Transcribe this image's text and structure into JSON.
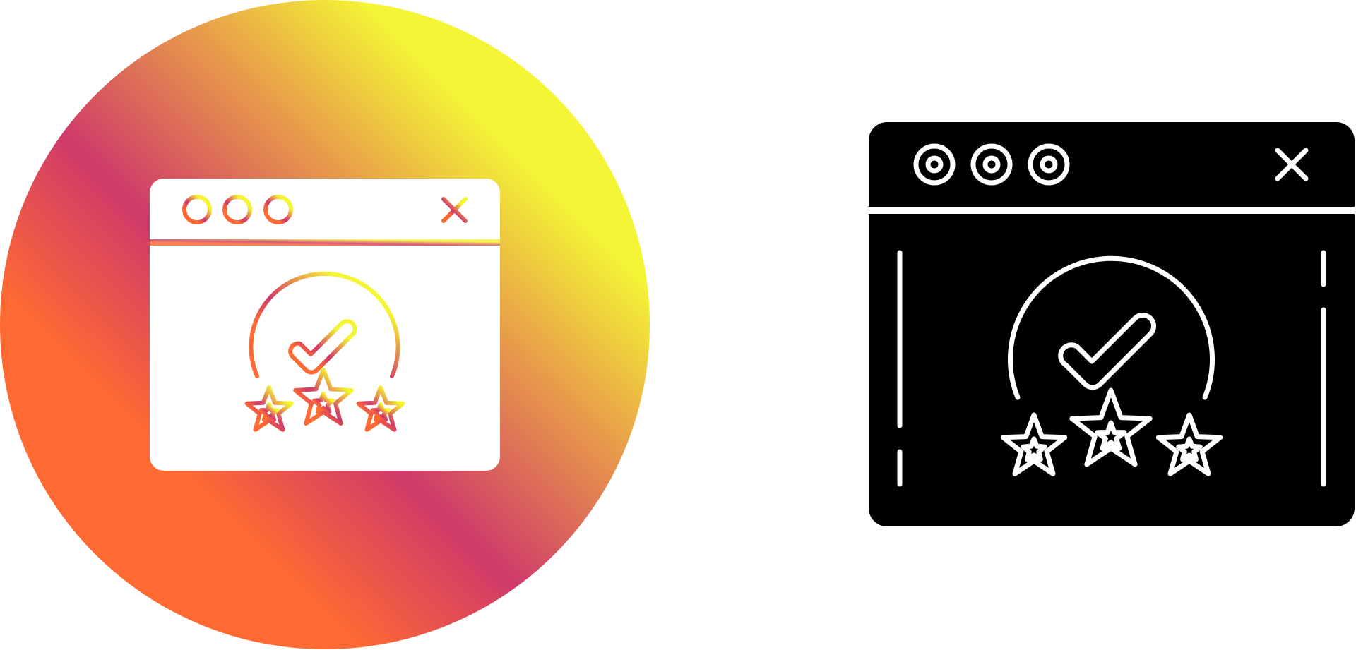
{
  "icons": {
    "gradient_variant": {
      "icon_name": "browser-rating-check-icon",
      "style": "gradient-circle",
      "colors": {
        "gradient_start": "#ff6a33",
        "gradient_mid": "#cf3a6a",
        "gradient_end": "#f3f535",
        "window_fill": "#ffffff"
      },
      "rating_stars": 3
    },
    "glyph_variant": {
      "icon_name": "browser-rating-check-icon",
      "style": "solid-glyph",
      "colors": {
        "window_fill": "#000000",
        "line_color": "#ffffff"
      },
      "rating_stars": 3
    }
  }
}
